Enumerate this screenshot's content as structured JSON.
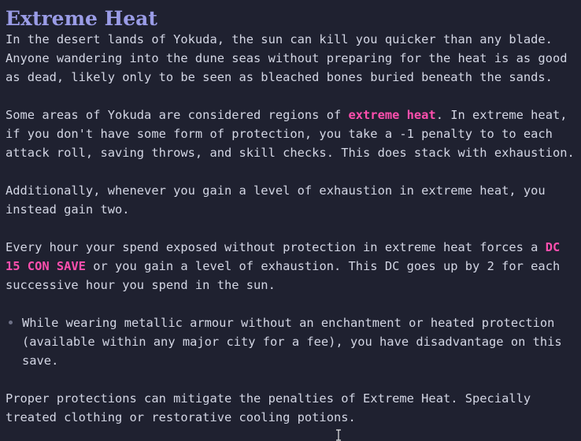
{
  "colors": {
    "background": "#1f2130",
    "text": "#d3d6e4",
    "heading": "#9a9ce6",
    "highlight": "#ff4fae"
  },
  "title": "Extreme Heat",
  "p1": "In the desert lands of Yokuda, the sun can kill you quicker than any blade. Anyone wandering into the dune seas without preparing for the heat is as good as dead, likely only to be seen as bleached bones buried beneath the sands.",
  "p2": {
    "before": "Some areas of Yokuda are considered regions of ",
    "highlight": "extreme heat",
    "after": ". In extreme heat, if you don't have some form of protection, you take a -1 penalty to to each attack roll, saving throws, and skill checks. This does stack with exhaustion."
  },
  "p3": "Additionally, whenever you gain a level of exhaustion in extreme heat, you instead gain two.",
  "p4": {
    "before": "Every hour your spend exposed without protection in extreme heat forces a ",
    "highlight": "DC 15 CON SAVE",
    "after": " or you gain a level of exhaustion. This DC goes up by 2 for each successive hour you spend in the sun."
  },
  "bullets": [
    "While wearing metallic armour without an enchantment or heated protection (available within any major city for a fee), you have disadvantage on this save."
  ],
  "p5": "Proper protections can mitigate the penalties of Extreme Heat. Specially treated clothing or restorative cooling potions."
}
